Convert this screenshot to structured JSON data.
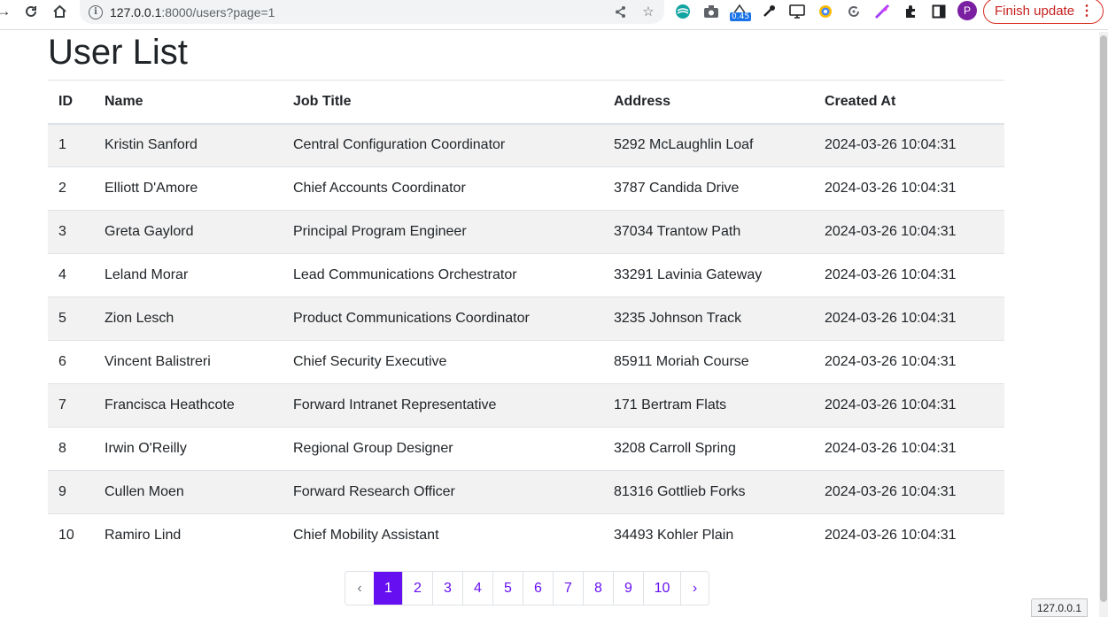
{
  "browser": {
    "url_host": "127.0.0.1",
    "url_rest": ":8000/users?page=1",
    "badge_text": "0.45",
    "avatar_letter": "P",
    "finish_update_label": "Finish update",
    "menu_dots": "⋮",
    "status_url": "127.0.0.1"
  },
  "page": {
    "title": "User List"
  },
  "table": {
    "headers": [
      "ID",
      "Name",
      "Job Title",
      "Address",
      "Created At"
    ],
    "rows": [
      [
        "1",
        "Kristin Sanford",
        "Central Configuration Coordinator",
        "5292 McLaughlin Loaf",
        "2024-03-26 10:04:31"
      ],
      [
        "2",
        "Elliott D'Amore",
        "Chief Accounts Coordinator",
        "3787 Candida Drive",
        "2024-03-26 10:04:31"
      ],
      [
        "3",
        "Greta Gaylord",
        "Principal Program Engineer",
        "37034 Trantow Path",
        "2024-03-26 10:04:31"
      ],
      [
        "4",
        "Leland Morar",
        "Lead Communications Orchestrator",
        "33291 Lavinia Gateway",
        "2024-03-26 10:04:31"
      ],
      [
        "5",
        "Zion Lesch",
        "Product Communications Coordinator",
        "3235 Johnson Track",
        "2024-03-26 10:04:31"
      ],
      [
        "6",
        "Vincent Balistreri",
        "Chief Security Executive",
        "85911 Moriah Course",
        "2024-03-26 10:04:31"
      ],
      [
        "7",
        "Francisca Heathcote",
        "Forward Intranet Representative",
        "171 Bertram Flats",
        "2024-03-26 10:04:31"
      ],
      [
        "8",
        "Irwin O'Reilly",
        "Regional Group Designer",
        "3208 Carroll Spring",
        "2024-03-26 10:04:31"
      ],
      [
        "9",
        "Cullen Moen",
        "Forward Research Officer",
        "81316 Gottlieb Forks",
        "2024-03-26 10:04:31"
      ],
      [
        "10",
        "Ramiro Lind",
        "Chief Mobility Assistant",
        "34493 Kohler Plain",
        "2024-03-26 10:04:31"
      ]
    ]
  },
  "pagination": {
    "prev": "‹",
    "pages": [
      "1",
      "2",
      "3",
      "4",
      "5",
      "6",
      "7",
      "8",
      "9",
      "10"
    ],
    "next": "›",
    "current": "1"
  },
  "colors": {
    "accent": "#6610f2",
    "stripe": "#f2f2f2",
    "update_red": "#d93025"
  }
}
